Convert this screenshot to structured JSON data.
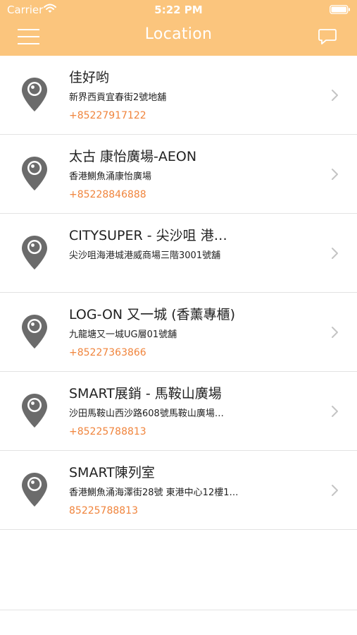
{
  "status_bar": {
    "carrier": "Carrier",
    "time": "5:22 PM"
  },
  "nav": {
    "title": "Location",
    "left_icon": "menu-icon",
    "right_icon": "chat-icon"
  },
  "colors": {
    "header_bg": "#fbc57d",
    "phone_text": "#f0843c",
    "pin_icon": "#6b6b6b"
  },
  "locations": [
    {
      "name": "佳好哟",
      "address": "新界西貢宜春街2號地舖",
      "phone": "+85227917122"
    },
    {
      "name": "太古  康怡廣場-AEON",
      "address": "香港鰂魚涌康怡廣場",
      "phone": "+85228846888"
    },
    {
      "name": "CITYSUPER - 尖沙咀 港…",
      "address": "尖沙咀海港城港威商場三階3001號舖",
      "phone": ""
    },
    {
      "name": "LOG-ON 又一城 (香薰專櫃)",
      "address": "九龍塘又一城UG層01號舖",
      "phone": "+85227363866"
    },
    {
      "name": "SMART展銷 - 馬鞍山廣場",
      "address": "沙田馬鞍山西沙路608號馬鞍山廣場…",
      "phone": "+85225788813"
    },
    {
      "name": "SMART陳列室",
      "address": "香港鰂魚涌海澤街28號 東港中心12樓1…",
      "phone": "85225788813"
    }
  ]
}
